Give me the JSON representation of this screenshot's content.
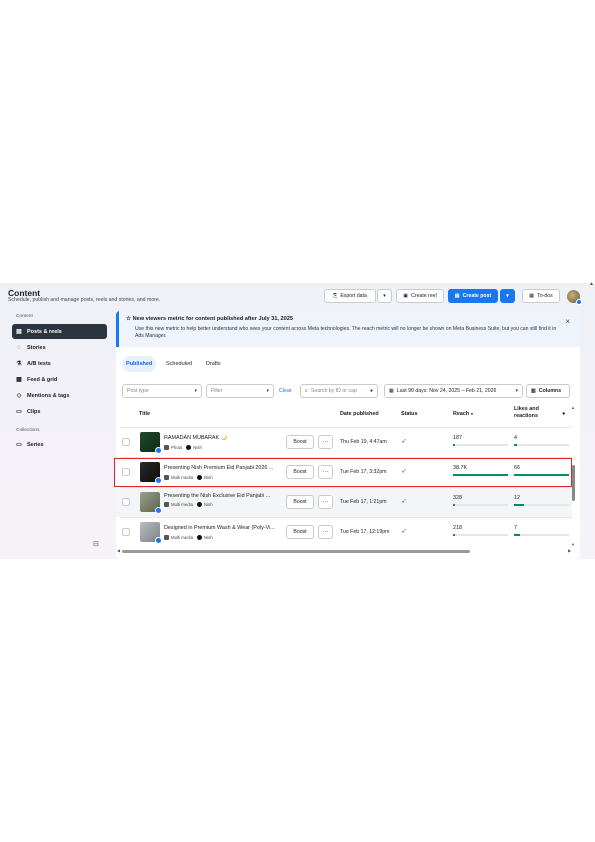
{
  "header": {
    "title": "Content",
    "subtitle": "Schedule, publish and manage posts, reels and stories, and more.",
    "export_label": "Export data",
    "create_reel_label": "Create reel",
    "create_post_label": "Create post",
    "todos_label": "To-dos"
  },
  "sidebar": {
    "content_heading": "Content",
    "collections_heading": "Collections",
    "items": [
      {
        "label": "Posts & reels",
        "icon": "posts-icon"
      },
      {
        "label": "Stories",
        "icon": "stories-icon"
      },
      {
        "label": "A/B tests",
        "icon": "flask-icon"
      },
      {
        "label": "Feed & grid",
        "icon": "grid-icon"
      },
      {
        "label": "Mentions & tags",
        "icon": "tag-icon"
      },
      {
        "label": "Clips",
        "icon": "clip-icon"
      }
    ],
    "series_label": "Series"
  },
  "banner": {
    "title": "New viewers metric for content published after July 31, 2025",
    "body": "Use this new metric to help better understand who sees your content across Meta technologies. The reach metric will no longer be shown on Meta Business Suite, but you can still find it in Ads Manager."
  },
  "tabs": [
    "Published",
    "Scheduled",
    "Drafts"
  ],
  "filters": {
    "post_type": "Post type",
    "filter": "Filter",
    "clear": "Clear",
    "search_placeholder": "Search by ID or cap",
    "date_range": "Last 90 days: Nov 24, 2025 – Feb 21, 2026",
    "columns": "Columns"
  },
  "table": {
    "columns": {
      "title": "Title",
      "date": "Date published",
      "status": "Status",
      "reach": "Reach",
      "likes": "Likes and reactions"
    },
    "boost_label": "Boost",
    "more_label": "···",
    "rows": [
      {
        "title": "RAMADAN MUBARAK 🌙",
        "type": "Photo",
        "page": "Nish",
        "date": "Thu Feb 19, 4:47am",
        "reach": "187",
        "likes": "4",
        "reach_fill": 0.01,
        "likes_fill": 0.06
      },
      {
        "title": "Presenting Nish Premium Eid Panjabi 2026 ...",
        "type": "Multi media",
        "page": "Nish",
        "date": "Tue Feb 17, 3:32pm",
        "reach": "38.7K",
        "likes": "66",
        "reach_fill": 1.0,
        "likes_fill": 1.0
      },
      {
        "title": "Presenting the Nish Exclusive Eid Panjabi ...",
        "type": "Multi media",
        "page": "Nish",
        "date": "Tue Feb 17, 1:21pm",
        "reach": "328",
        "likes": "12",
        "reach_fill": 0.01,
        "likes_fill": 0.18
      },
      {
        "title": "Designed in Premium Wash & Wear (Poly-Vi...",
        "type": "Multi media",
        "page": "Nish",
        "date": "Tue Feb 17, 12:19pm",
        "reach": "218",
        "likes": "7",
        "reach_fill": 0.01,
        "likes_fill": 0.1
      }
    ]
  },
  "colors": {
    "accent": "#1877f2",
    "highlight_border": "#e0242a",
    "bar_fill": "#0e8a5f"
  }
}
